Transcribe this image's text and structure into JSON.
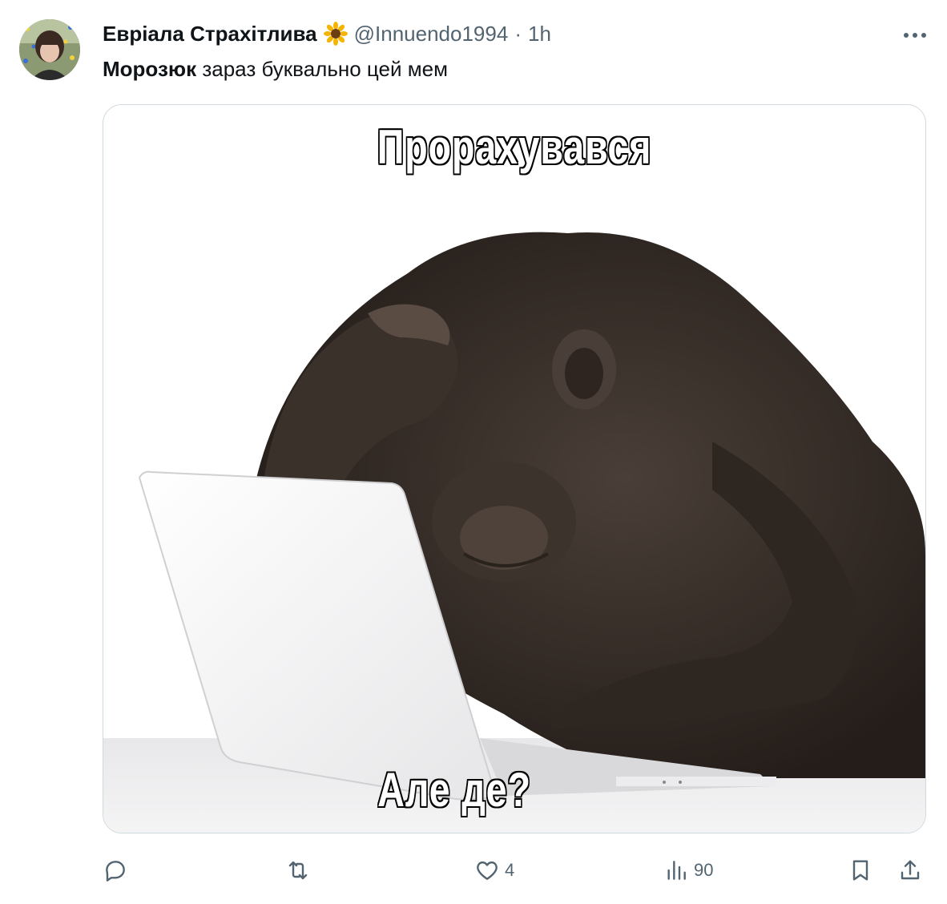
{
  "author": {
    "display_name": "Евріала Страхітлива",
    "badge_icon": "sunflower-icon",
    "handle": "@Innuendo1994",
    "separator": "·",
    "time": "1h"
  },
  "text": {
    "bold": "Морозюк",
    "rest": " зараз буквально цей мем"
  },
  "media": {
    "caption_top": "Прорахувався",
    "caption_bottom": "Але де?"
  },
  "actions": {
    "reply": {
      "icon": "reply-icon",
      "count": ""
    },
    "retweet": {
      "icon": "retweet-icon",
      "count": ""
    },
    "like": {
      "icon": "heart-icon",
      "count": "4"
    },
    "views": {
      "icon": "views-icon",
      "count": "90"
    },
    "bookmark": {
      "icon": "bookmark-icon"
    },
    "share": {
      "icon": "share-icon"
    }
  },
  "colors": {
    "text_primary": "#0f1419",
    "text_secondary": "#536471",
    "border": "#cfd9de"
  }
}
